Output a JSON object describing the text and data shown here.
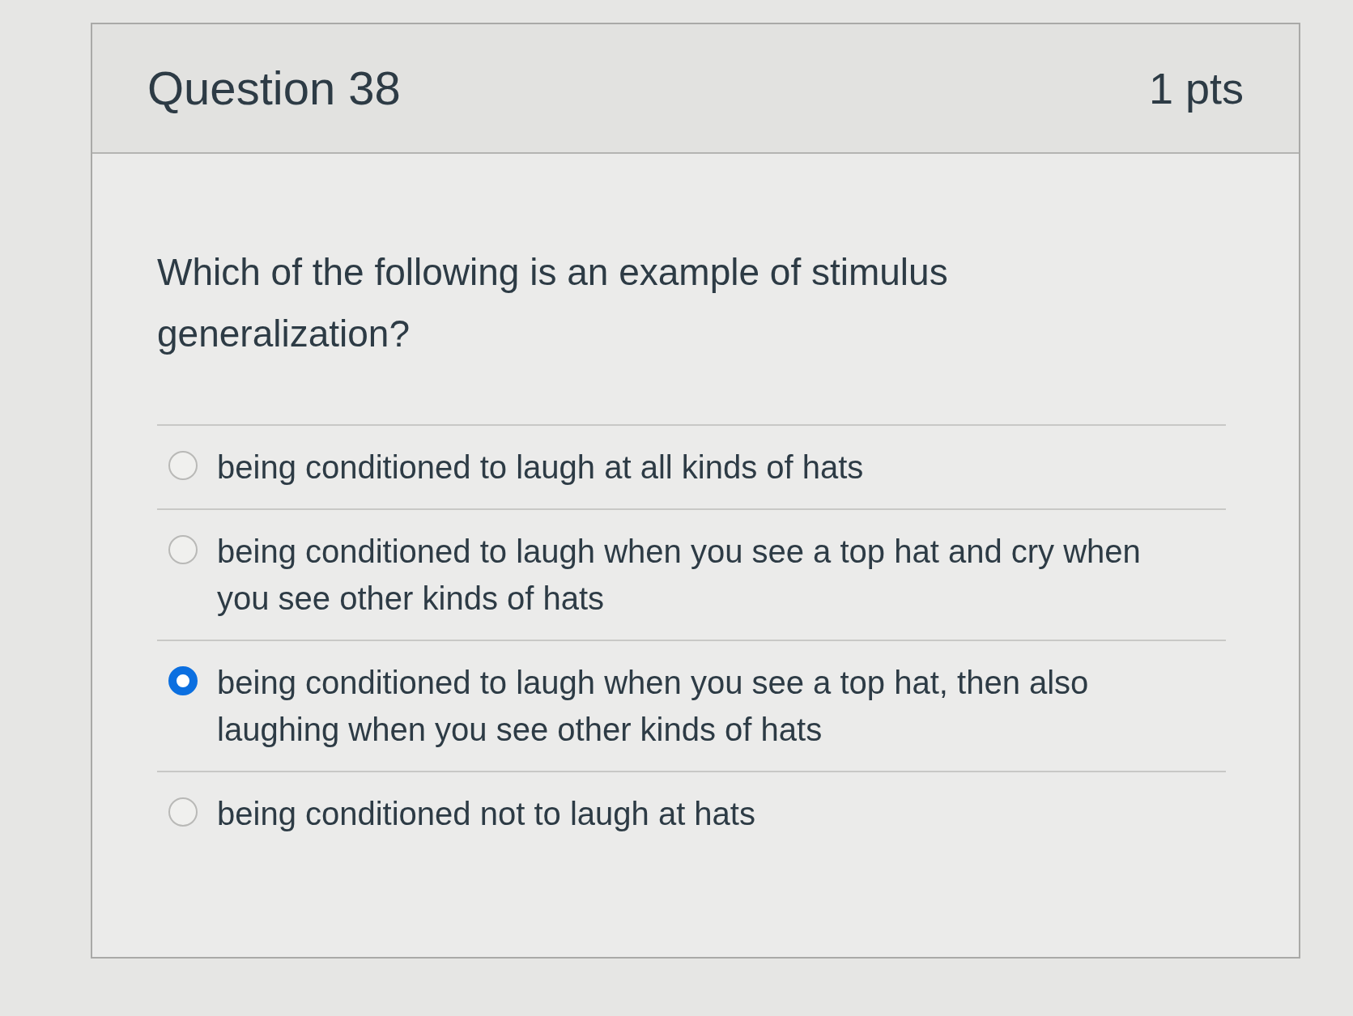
{
  "question": {
    "title": "Question 38",
    "points": "1 pts",
    "text": "Which of the following is an example of stimulus generalization?"
  },
  "answers": [
    {
      "label": "being conditioned to laugh at all kinds of hats",
      "selected": false
    },
    {
      "label": "being conditioned to laugh when you see a top hat and cry when you see other kinds of hats",
      "selected": false
    },
    {
      "label": "being conditioned to laugh when you see a top hat, then also laughing when you see other kinds of hats",
      "selected": true
    },
    {
      "label": "being conditioned not to laugh at hats",
      "selected": false
    }
  ]
}
